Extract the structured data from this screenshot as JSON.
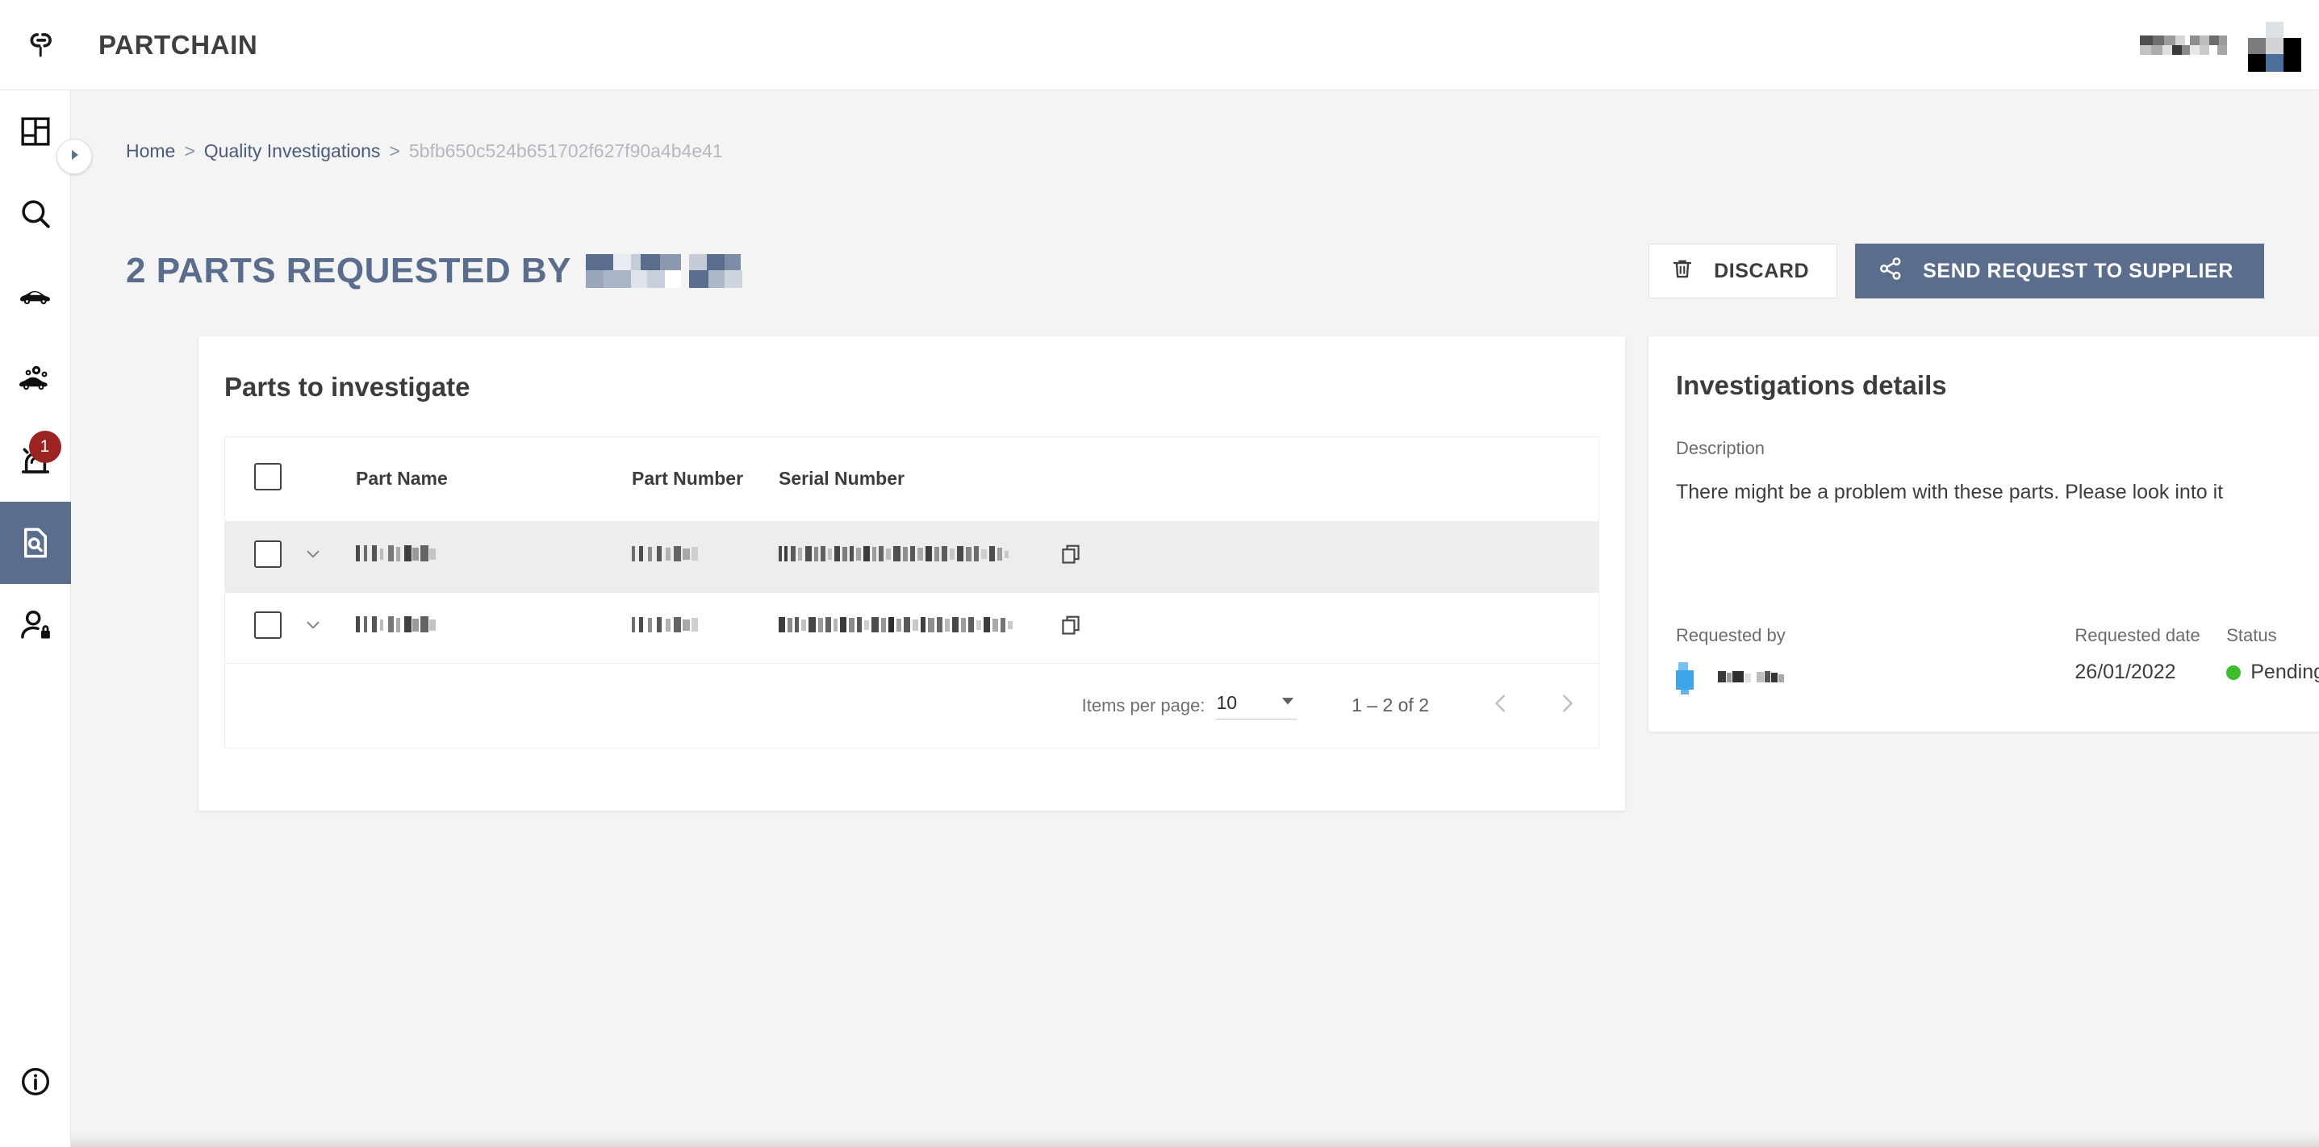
{
  "app": {
    "brand": "PARTCHAIN",
    "logo_icon": "chain-link-icon",
    "user_name_redacted": true,
    "avatar_redacted": true
  },
  "sidebar": {
    "toggle_icon": "chevron-right-icon",
    "items": [
      {
        "name": "dashboard",
        "icon": "dashboard-grid-icon",
        "active": false,
        "badge": null
      },
      {
        "name": "search",
        "icon": "search-icon",
        "active": false,
        "badge": null
      },
      {
        "name": "vehicles",
        "icon": "car-icon",
        "active": false,
        "badge": null
      },
      {
        "name": "parts",
        "icon": "car-parts-icon",
        "active": false,
        "badge": null
      },
      {
        "name": "alerts",
        "icon": "alert-siren-icon",
        "active": false,
        "badge": "1"
      },
      {
        "name": "quality-investigations",
        "icon": "document-search-icon",
        "active": true,
        "badge": null
      },
      {
        "name": "access-management",
        "icon": "user-lock-icon",
        "active": false,
        "badge": null
      }
    ],
    "bottom_item": {
      "name": "about",
      "icon": "info-circle-icon"
    }
  },
  "breadcrumb": {
    "home": "Home",
    "section": "Quality Investigations",
    "id": "5bfb650c524b651702f627f90a4b4e41",
    "separator": ">"
  },
  "page": {
    "title": "2 PARTS REQUESTED BY",
    "title_suffix_redacted": true
  },
  "actions": {
    "discard_label": "DISCARD",
    "discard_icon": "trash-icon",
    "send_label": "SEND REQUEST TO SUPPLIER",
    "send_icon": "share-nodes-icon",
    "send_bg": "#5b6d8c"
  },
  "parts_card": {
    "title": "Parts to investigate",
    "columns": [
      "Part Name",
      "Part Number",
      "Serial Number"
    ],
    "select_all_checked": false,
    "rows": [
      {
        "checked": false,
        "expand_icon": "chevron-down-icon",
        "part_name": "",
        "part_number": "",
        "serial_number": "",
        "copy_icon": "copy-icon",
        "redacted": true,
        "highlighted": true
      },
      {
        "checked": false,
        "expand_icon": "chevron-down-icon",
        "part_name": "",
        "part_number": "",
        "serial_number": "",
        "copy_icon": "copy-icon",
        "redacted": true,
        "highlighted": false
      }
    ],
    "paginator": {
      "items_per_page_label": "Items per page:",
      "items_per_page_value": "10",
      "dropdown_icon": "caret-down-icon",
      "range_label": "1 – 2 of 2",
      "prev_icon": "chevron-left-icon",
      "next_icon": "chevron-right-icon",
      "prev_disabled": true,
      "next_disabled": true
    }
  },
  "details_card": {
    "title": "Investigations details",
    "description_label": "Description",
    "description_text": "There might be a problem with these parts. Please look into it",
    "requested_by_label": "Requested by",
    "requested_by_value_redacted": true,
    "requested_date_label": "Requested date",
    "requested_date_value": "26/01/2022",
    "status_label": "Status",
    "status_value": "Pending",
    "status_color": "#3dbd2e"
  },
  "theme": {
    "accent": "#5b6d8c",
    "badge_red": "#9b2423",
    "page_bg": "#f4f4f4",
    "card_bg": "#ffffff"
  }
}
